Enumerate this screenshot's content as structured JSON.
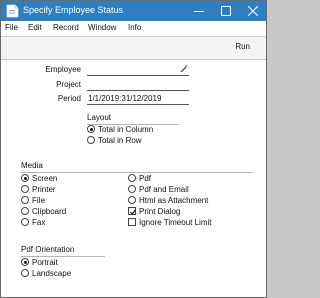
{
  "window": {
    "title": "Specify Employee Status",
    "app_icon": "hansa-app-icon",
    "buttons": [
      "minimize-icon",
      "maximize-icon",
      "close-icon"
    ]
  },
  "menubar": {
    "items": [
      "File",
      "Edit",
      "Record",
      "Window",
      "Info"
    ]
  },
  "toolbar": {
    "run_label": "Run"
  },
  "fields": {
    "employee": {
      "label": "Employee",
      "value": ""
    },
    "project": {
      "label": "Project",
      "value": ""
    },
    "period": {
      "label": "Period",
      "value": "1/1/2019:31/12/2019"
    }
  },
  "layout": {
    "title": "Layout",
    "options": [
      {
        "label": "Total in Column",
        "selected": true
      },
      {
        "label": "Total in Row",
        "selected": false
      }
    ]
  },
  "media": {
    "title": "Media",
    "left_options": [
      {
        "label": "Screen",
        "selected": true
      },
      {
        "label": "Printer",
        "selected": false
      },
      {
        "label": "File",
        "selected": false
      },
      {
        "label": "Clipboard",
        "selected": false
      },
      {
        "label": "Fax",
        "selected": false
      }
    ],
    "right_options": [
      {
        "label": "Pdf",
        "selected": false
      },
      {
        "label": "Pdf and Email",
        "selected": false
      },
      {
        "label": "Html as Attachment",
        "selected": false
      }
    ],
    "checkboxes": [
      {
        "label": "Print Dialog",
        "checked": true
      },
      {
        "label": "Ignore Timeout Limit",
        "checked": false
      }
    ]
  },
  "pdf_orientation": {
    "title": "Pdf Orientation",
    "options": [
      {
        "label": "Portrait",
        "selected": true
      },
      {
        "label": "Landscape",
        "selected": false
      }
    ]
  },
  "colors": {
    "titlebar": "#2d7fc1",
    "window_bg": "#ffffff",
    "toolbar_bg": "#f4f4f4"
  }
}
